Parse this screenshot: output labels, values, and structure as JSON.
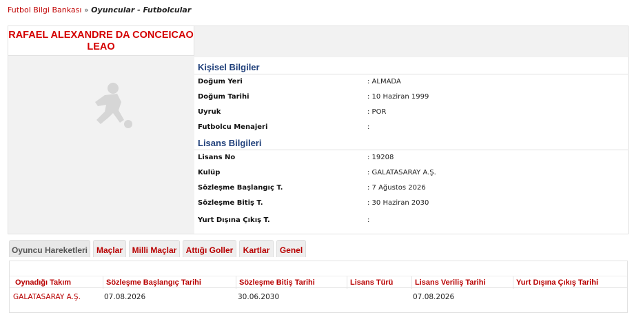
{
  "breadcrumb": {
    "root": "Futbol Bilgi Bankası",
    "separator": "»",
    "current": "Oyuncular - Futbolcular"
  },
  "player": {
    "name_line1": "RAFAEL ALEXANDRE DA CONCEICAO",
    "name_line2": "LEAO"
  },
  "personal": {
    "title": "Kişisel Bilgiler",
    "rows": [
      {
        "label": "Doğum Yeri",
        "value": ":  ALMADA"
      },
      {
        "label": "Doğum Tarihi",
        "value": ":  10 Haziran 1999"
      },
      {
        "label": "Uyruk",
        "value": ":  POR"
      },
      {
        "label": "Futbolcu Menajeri",
        "value": ":"
      }
    ]
  },
  "license": {
    "title": "Lisans Bilgileri",
    "rows": [
      {
        "label": "Lisans No",
        "value": ": 19208"
      },
      {
        "label": "Kulüp",
        "value": ": GALATASARAY A.Ş."
      },
      {
        "label": "Sözleşme Başlangıç T.",
        "value": ": 7 Ağustos 2026"
      },
      {
        "label": "Sözleşme Bitiş T.",
        "value": ": 30 Haziran 2030"
      },
      {
        "label": "Yurt Dışına Çıkış T.",
        "value": ":"
      }
    ]
  },
  "tabs": [
    "Oyuncu Hareketleri",
    "Maçlar",
    "Milli Maçlar",
    "Attığı Goller",
    "Kartlar",
    "Genel"
  ],
  "movements": {
    "headers": [
      "Oynadığı Takım",
      "Sözleşme Başlangıç Tarihi",
      "Sözleşme Bitiş Tarihi",
      "Lisans Türü",
      "Lisans Veriliş Tarihi",
      "Yurt Dışına Çıkış Tarihi"
    ],
    "rows": [
      {
        "club": "GALATASARAY A.Ş.",
        "start": "07.08.2026",
        "end": "30.06.2030",
        "license_type": "",
        "issued": "07.08.2026",
        "abroad": ""
      }
    ]
  },
  "colors": {
    "accent_red": "#c00000",
    "section_blue": "#1f3f7a"
  }
}
